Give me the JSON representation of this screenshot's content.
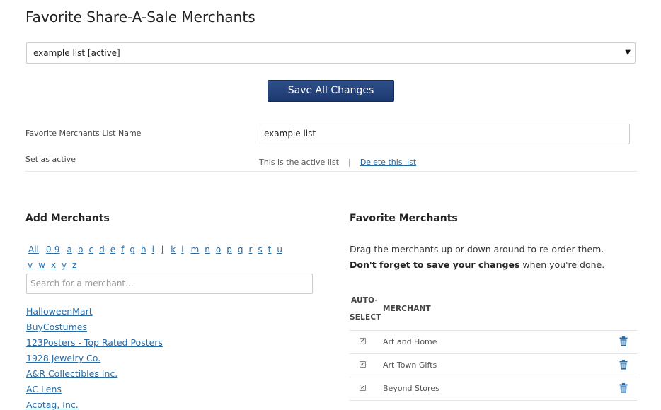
{
  "page": {
    "title": "Favorite Share-A-Sale Merchants"
  },
  "list_select": {
    "selected": "example list [active]"
  },
  "save_button": {
    "label": "Save All Changes"
  },
  "form": {
    "name_label": "Favorite Merchants List Name",
    "name_value": "example list",
    "active_label": "Set as active",
    "active_status": "This is the active list",
    "separator": "|",
    "delete_link": "Delete this list"
  },
  "add_merchants": {
    "title": "Add Merchants",
    "alphabet_row1": [
      "All",
      "0-9",
      "a",
      "b",
      "c",
      "d",
      "e",
      "f",
      "g",
      "h",
      "i",
      "j",
      "k",
      "l",
      "m",
      "n",
      "o",
      "p",
      "q",
      "r",
      "s",
      "t",
      "u"
    ],
    "alphabet_row2": [
      "v",
      "w",
      "x",
      "y",
      "z"
    ],
    "search_placeholder": "Search for a merchant...",
    "merchants": [
      "HalloweenMart",
      "BuyCostumes",
      "123Posters - Top Rated Posters",
      "1928 Jewelry Co.",
      "A&R Collectibles Inc.",
      "AC Lens",
      "Acotag, Inc."
    ]
  },
  "favorites": {
    "title": "Favorite Merchants",
    "instructions_plain_1": "Drag the merchants up or down around to re-order them. ",
    "instructions_bold": "Don't forget to save your changes",
    "instructions_plain_2": " when you're done.",
    "col_auto_line1": "AUTO-",
    "col_auto_line2": "SELECT",
    "col_merchant": "MERCHANT",
    "rows": [
      {
        "name": "Art and Home",
        "auto_select": true
      },
      {
        "name": "Art Town Gifts",
        "auto_select": true
      },
      {
        "name": "Beyond Stores",
        "auto_select": true
      }
    ]
  },
  "colors": {
    "accent": "#1d3a70",
    "link": "#2a6ba3",
    "trash": "#2a6ba3"
  },
  "icons": {
    "dropdown": "caret-down-icon",
    "delete": "trash-icon",
    "checkbox": "checkmark-icon"
  }
}
